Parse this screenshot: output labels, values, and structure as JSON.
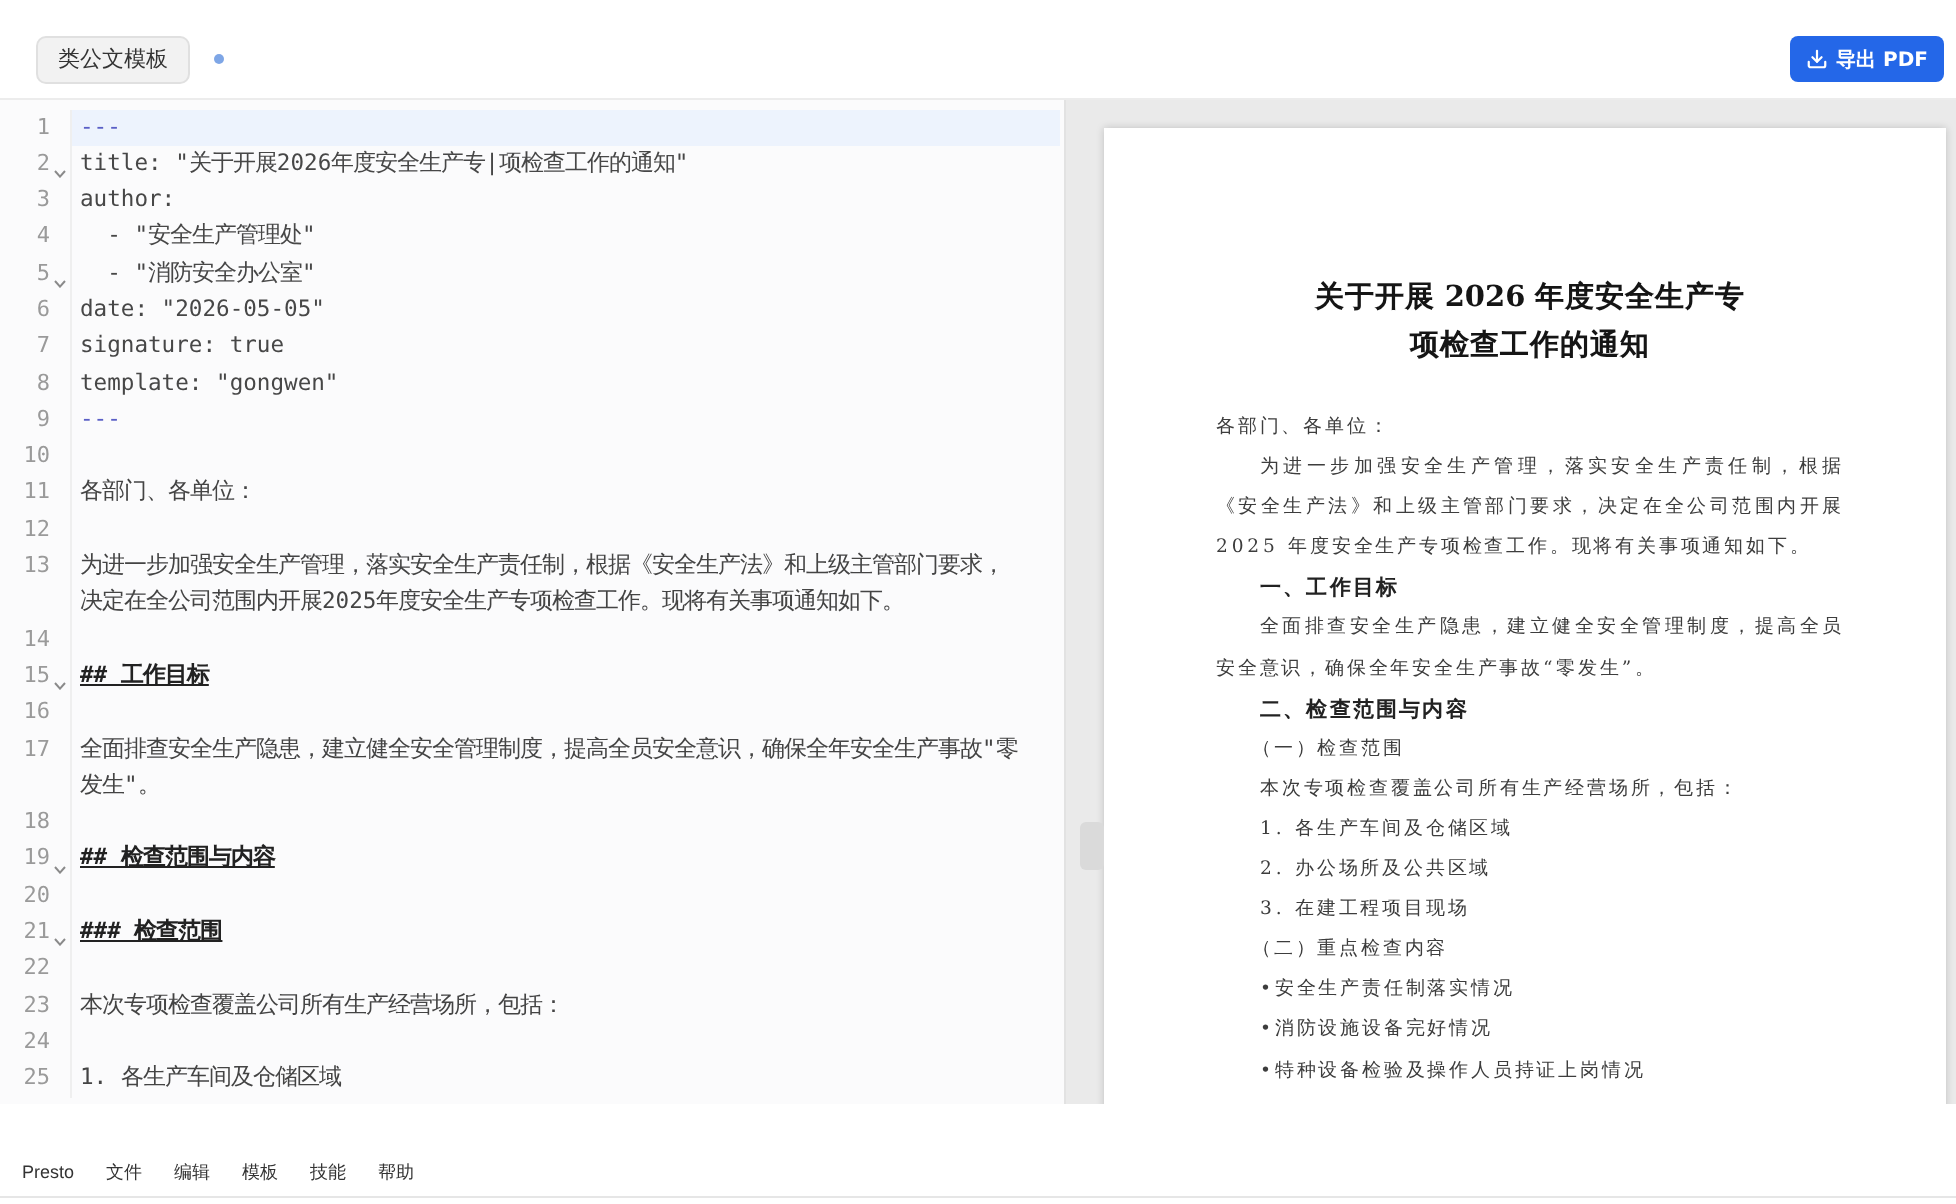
{
  "toolbar": {
    "template_button": "类公文模板",
    "modified": true,
    "export_button": "导出 PDF"
  },
  "editor": {
    "lines": [
      {
        "number": "1",
        "kind": "delimiter",
        "text": "---",
        "foldable": false,
        "active": true
      },
      {
        "number": "2",
        "kind": "yaml",
        "text": "title: \"关于开展2026年度安全生产专|项检查工作的通知\"",
        "foldable": true,
        "active": false
      },
      {
        "number": "3",
        "kind": "yaml",
        "text": "author:",
        "foldable": false,
        "active": false
      },
      {
        "number": "4",
        "kind": "yaml",
        "text": "  - \"安全生产管理处\"",
        "foldable": false,
        "active": false
      },
      {
        "number": "5",
        "kind": "yaml",
        "text": "  - \"消防安全办公室\"",
        "foldable": true,
        "active": false
      },
      {
        "number": "6",
        "kind": "yaml",
        "text": "date: \"2026-05-05\"",
        "foldable": false,
        "active": false
      },
      {
        "number": "7",
        "kind": "yaml",
        "text": "signature: true",
        "foldable": false,
        "active": false
      },
      {
        "number": "8",
        "kind": "yaml",
        "text": "template: \"gongwen\"",
        "foldable": false,
        "active": false
      },
      {
        "number": "9",
        "kind": "delimiter",
        "text": "---",
        "foldable": false,
        "active": false
      },
      {
        "number": "10",
        "kind": "blank",
        "foldable": false,
        "active": false
      },
      {
        "number": "11",
        "kind": "text",
        "text": "各部门、各单位：",
        "foldable": false,
        "active": false
      },
      {
        "number": "12",
        "kind": "blank",
        "foldable": false,
        "active": false
      },
      {
        "number": "13",
        "kind": "text",
        "text": "为进一步加强安全生产管理，落实安全生产责任制，根据《安全生产法》和上级主管部门要求，决定在全公司范围内开展2025年度安全生产专项检查工作。现将有关事项通知如下。",
        "foldable": false,
        "active": false
      },
      {
        "number": "14",
        "kind": "blank",
        "foldable": false,
        "active": false
      },
      {
        "number": "15",
        "kind": "heading",
        "text": "## 工作目标",
        "foldable": true,
        "active": false
      },
      {
        "number": "16",
        "kind": "blank",
        "foldable": false,
        "active": false
      },
      {
        "number": "17",
        "kind": "text",
        "text": "全面排查安全生产隐患，建立健全安全管理制度，提高全员安全意识，确保全年安全生产事故\"零发生\"。",
        "foldable": false,
        "active": false
      },
      {
        "number": "18",
        "kind": "blank",
        "foldable": false,
        "active": false
      },
      {
        "number": "19",
        "kind": "heading",
        "text": "## 检查范围与内容",
        "foldable": true,
        "active": false
      },
      {
        "number": "20",
        "kind": "blank",
        "foldable": false,
        "active": false
      },
      {
        "number": "21",
        "kind": "heading",
        "text": "### 检查范围",
        "foldable": true,
        "active": false
      },
      {
        "number": "22",
        "kind": "blank",
        "foldable": false,
        "active": false
      },
      {
        "number": "23",
        "kind": "text",
        "text": "本次专项检查覆盖公司所有生产经营场所，包括：",
        "foldable": false,
        "active": false
      },
      {
        "number": "24",
        "kind": "blank",
        "foldable": false,
        "active": false
      },
      {
        "number": "25",
        "kind": "text",
        "text": "1. 各生产车间及仓储区域",
        "foldable": false,
        "active": false
      }
    ]
  },
  "preview": {
    "title_lines": [
      "关于开展 2026 年度安全生产专",
      "项检查工作的通知"
    ],
    "blocks": [
      {
        "kind": "salutation",
        "text": "各部门、各单位："
      },
      {
        "kind": "paragraph",
        "text": "为进一步加强安全生产管理，落实安全生产责任制，根据《安全生产法》和上级主管部门要求，决定在全公司范围内开展 2025 年度安全生产专项检查工作。现将有关事项通知如下。"
      },
      {
        "kind": "heading",
        "text": "一、工作目标"
      },
      {
        "kind": "paragraph",
        "text": "全面排查安全生产隐患，建立健全安全管理制度，提高全员安全意识，确保全年安全生产事故“零发生”。"
      },
      {
        "kind": "heading",
        "text": "二、检查范围与内容"
      },
      {
        "kind": "subheading",
        "text": "（一）检查范围"
      },
      {
        "kind": "plain",
        "text": "本次专项检查覆盖公司所有生产经营场所，包括："
      },
      {
        "kind": "list_item",
        "text": "1. 各生产车间及仓储区域"
      },
      {
        "kind": "list_item",
        "text": "2. 办公场所及公共区域"
      },
      {
        "kind": "list_item",
        "text": "3. 在建工程项目现场"
      },
      {
        "kind": "subheading",
        "text": "（二）重点检查内容"
      },
      {
        "kind": "list_item",
        "text": "•安全生产责任制落实情况"
      },
      {
        "kind": "list_item",
        "text": "•消防设施设备完好情况"
      },
      {
        "kind": "list_item",
        "text": "•特种设备检验及操作人员持证上岗情况"
      }
    ]
  },
  "menu_bar": {
    "items": [
      "Presto",
      "文件",
      "编辑",
      "模板",
      "技能",
      "帮助"
    ]
  }
}
